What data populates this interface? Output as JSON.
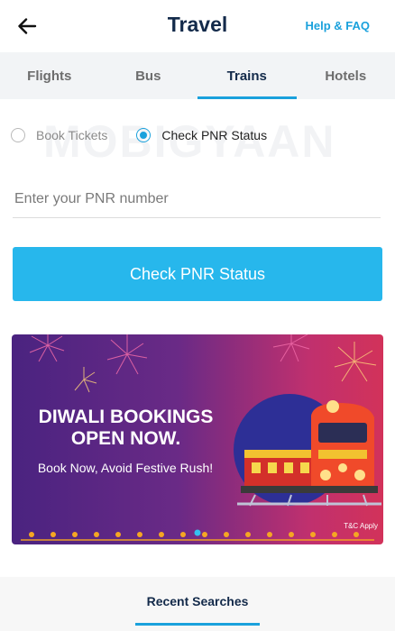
{
  "header": {
    "title": "Travel",
    "help": "Help & FAQ"
  },
  "tabs": [
    {
      "label": "Flights"
    },
    {
      "label": "Bus"
    },
    {
      "label": "Trains"
    },
    {
      "label": "Hotels"
    }
  ],
  "active_tab": "Trains",
  "options": {
    "book": "Book Tickets",
    "pnr": "Check PNR Status",
    "selected": "Check PNR Status"
  },
  "watermark": "MOBIGYAAN",
  "pnr_input": {
    "value": "",
    "placeholder": "Enter your PNR number"
  },
  "cta": "Check PNR Status",
  "banner": {
    "line1": "DIWALI BOOKINGS",
    "line2": "OPEN NOW.",
    "sub": "Book Now, Avoid Festive Rush!",
    "tc": "T&C Apply"
  },
  "recent": "Recent Searches",
  "colors": {
    "accent": "#1aa1dc",
    "cta": "#27b7ec",
    "title": "#132a4a"
  }
}
